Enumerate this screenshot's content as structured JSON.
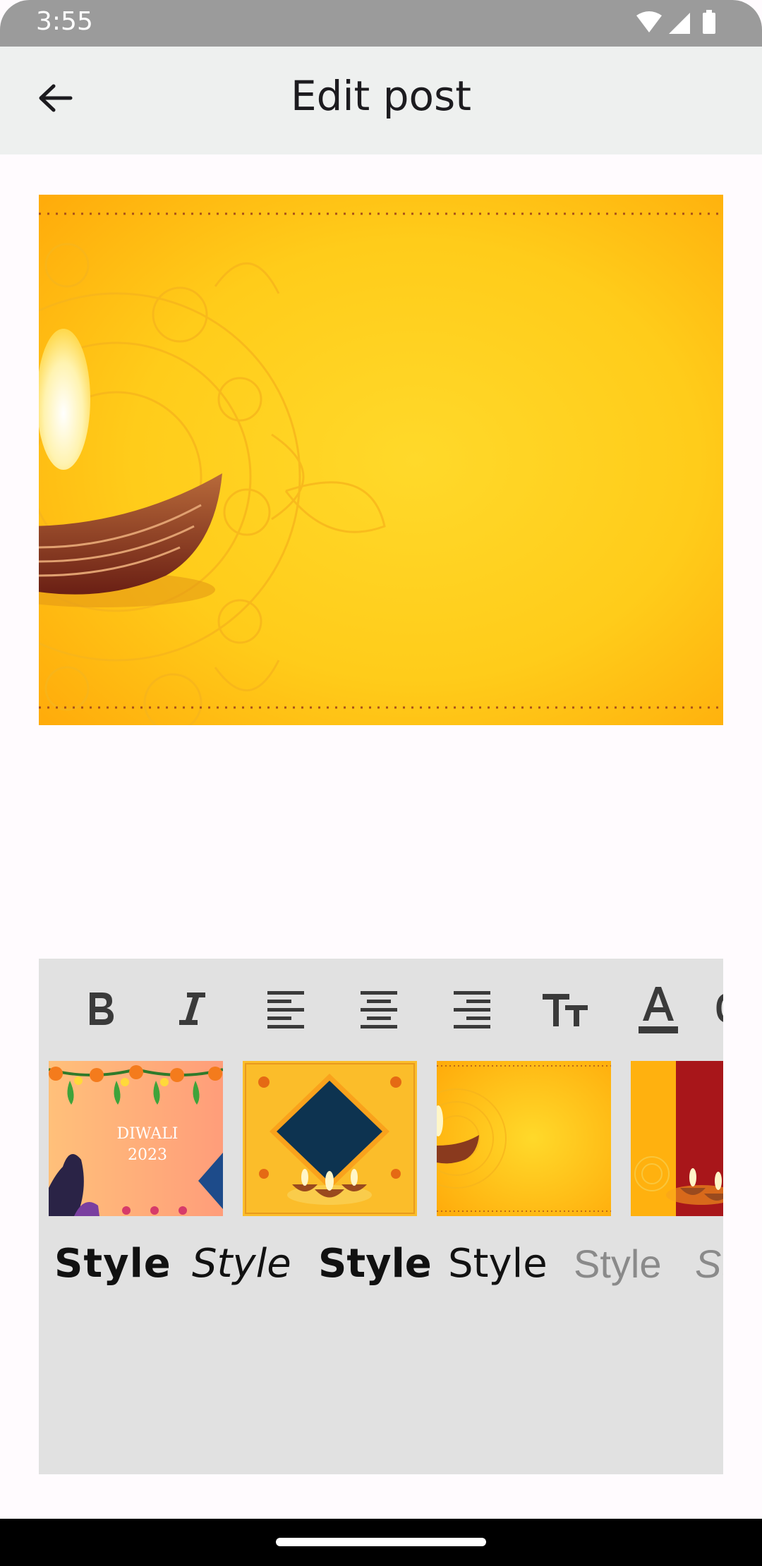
{
  "status": {
    "time": "3:55"
  },
  "appbar": {
    "title": "Edit post"
  },
  "toolbar": {
    "tools": [
      "bold",
      "italic",
      "align-left",
      "align-center",
      "align-right",
      "text-size",
      "text-color"
    ]
  },
  "thumbnails": {
    "items": [
      {
        "title": "DIWALI",
        "subtitle": "2023"
      }
    ]
  },
  "styles": {
    "labels": [
      "Style",
      "Style",
      "Style",
      "Style",
      "Style",
      "St"
    ]
  }
}
